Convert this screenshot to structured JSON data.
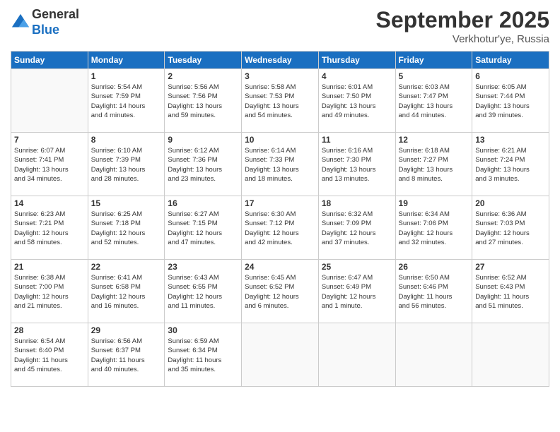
{
  "header": {
    "logo_line1": "General",
    "logo_line2": "Blue",
    "month_title": "September 2025",
    "subtitle": "Verkhotur'ye, Russia"
  },
  "weekdays": [
    "Sunday",
    "Monday",
    "Tuesday",
    "Wednesday",
    "Thursday",
    "Friday",
    "Saturday"
  ],
  "weeks": [
    [
      {
        "day": "",
        "info": ""
      },
      {
        "day": "1",
        "info": "Sunrise: 5:54 AM\nSunset: 7:59 PM\nDaylight: 14 hours\nand 4 minutes."
      },
      {
        "day": "2",
        "info": "Sunrise: 5:56 AM\nSunset: 7:56 PM\nDaylight: 13 hours\nand 59 minutes."
      },
      {
        "day": "3",
        "info": "Sunrise: 5:58 AM\nSunset: 7:53 PM\nDaylight: 13 hours\nand 54 minutes."
      },
      {
        "day": "4",
        "info": "Sunrise: 6:01 AM\nSunset: 7:50 PM\nDaylight: 13 hours\nand 49 minutes."
      },
      {
        "day": "5",
        "info": "Sunrise: 6:03 AM\nSunset: 7:47 PM\nDaylight: 13 hours\nand 44 minutes."
      },
      {
        "day": "6",
        "info": "Sunrise: 6:05 AM\nSunset: 7:44 PM\nDaylight: 13 hours\nand 39 minutes."
      }
    ],
    [
      {
        "day": "7",
        "info": "Sunrise: 6:07 AM\nSunset: 7:41 PM\nDaylight: 13 hours\nand 34 minutes."
      },
      {
        "day": "8",
        "info": "Sunrise: 6:10 AM\nSunset: 7:39 PM\nDaylight: 13 hours\nand 28 minutes."
      },
      {
        "day": "9",
        "info": "Sunrise: 6:12 AM\nSunset: 7:36 PM\nDaylight: 13 hours\nand 23 minutes."
      },
      {
        "day": "10",
        "info": "Sunrise: 6:14 AM\nSunset: 7:33 PM\nDaylight: 13 hours\nand 18 minutes."
      },
      {
        "day": "11",
        "info": "Sunrise: 6:16 AM\nSunset: 7:30 PM\nDaylight: 13 hours\nand 13 minutes."
      },
      {
        "day": "12",
        "info": "Sunrise: 6:18 AM\nSunset: 7:27 PM\nDaylight: 13 hours\nand 8 minutes."
      },
      {
        "day": "13",
        "info": "Sunrise: 6:21 AM\nSunset: 7:24 PM\nDaylight: 13 hours\nand 3 minutes."
      }
    ],
    [
      {
        "day": "14",
        "info": "Sunrise: 6:23 AM\nSunset: 7:21 PM\nDaylight: 12 hours\nand 58 minutes."
      },
      {
        "day": "15",
        "info": "Sunrise: 6:25 AM\nSunset: 7:18 PM\nDaylight: 12 hours\nand 52 minutes."
      },
      {
        "day": "16",
        "info": "Sunrise: 6:27 AM\nSunset: 7:15 PM\nDaylight: 12 hours\nand 47 minutes."
      },
      {
        "day": "17",
        "info": "Sunrise: 6:30 AM\nSunset: 7:12 PM\nDaylight: 12 hours\nand 42 minutes."
      },
      {
        "day": "18",
        "info": "Sunrise: 6:32 AM\nSunset: 7:09 PM\nDaylight: 12 hours\nand 37 minutes."
      },
      {
        "day": "19",
        "info": "Sunrise: 6:34 AM\nSunset: 7:06 PM\nDaylight: 12 hours\nand 32 minutes."
      },
      {
        "day": "20",
        "info": "Sunrise: 6:36 AM\nSunset: 7:03 PM\nDaylight: 12 hours\nand 27 minutes."
      }
    ],
    [
      {
        "day": "21",
        "info": "Sunrise: 6:38 AM\nSunset: 7:00 PM\nDaylight: 12 hours\nand 21 minutes."
      },
      {
        "day": "22",
        "info": "Sunrise: 6:41 AM\nSunset: 6:58 PM\nDaylight: 12 hours\nand 16 minutes."
      },
      {
        "day": "23",
        "info": "Sunrise: 6:43 AM\nSunset: 6:55 PM\nDaylight: 12 hours\nand 11 minutes."
      },
      {
        "day": "24",
        "info": "Sunrise: 6:45 AM\nSunset: 6:52 PM\nDaylight: 12 hours\nand 6 minutes."
      },
      {
        "day": "25",
        "info": "Sunrise: 6:47 AM\nSunset: 6:49 PM\nDaylight: 12 hours\nand 1 minute."
      },
      {
        "day": "26",
        "info": "Sunrise: 6:50 AM\nSunset: 6:46 PM\nDaylight: 11 hours\nand 56 minutes."
      },
      {
        "day": "27",
        "info": "Sunrise: 6:52 AM\nSunset: 6:43 PM\nDaylight: 11 hours\nand 51 minutes."
      }
    ],
    [
      {
        "day": "28",
        "info": "Sunrise: 6:54 AM\nSunset: 6:40 PM\nDaylight: 11 hours\nand 45 minutes."
      },
      {
        "day": "29",
        "info": "Sunrise: 6:56 AM\nSunset: 6:37 PM\nDaylight: 11 hours\nand 40 minutes."
      },
      {
        "day": "30",
        "info": "Sunrise: 6:59 AM\nSunset: 6:34 PM\nDaylight: 11 hours\nand 35 minutes."
      },
      {
        "day": "",
        "info": ""
      },
      {
        "day": "",
        "info": ""
      },
      {
        "day": "",
        "info": ""
      },
      {
        "day": "",
        "info": ""
      }
    ]
  ]
}
